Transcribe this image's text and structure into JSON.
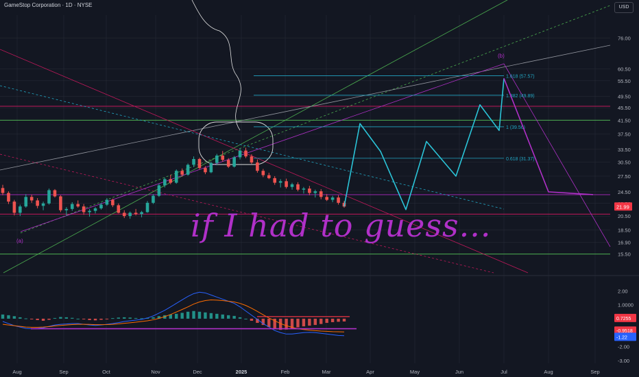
{
  "header": {
    "title": "GameStop Corporation · 1D · NYSE",
    "currency_button": "USD"
  },
  "annotation_text": "if I had to guess...",
  "colors": {
    "background": "#131722",
    "up": "#26a69a",
    "down": "#ef5350",
    "grid": "#2a2e39",
    "wick": "#4c5260",
    "fib": "#22a7c4",
    "magenta": "#b030c8",
    "cyan_sketch": "#2bc4d8",
    "green_line": "#4caf50",
    "red_level": "#c2185b",
    "macd_line": "#2962ff",
    "signal_line": "#ff6d00",
    "price_tag": "#f23645"
  },
  "chart_data": [
    {
      "type": "candlestick",
      "title": "GameStop Corporation · 1D · NYSE",
      "ylim": [
        13.5,
        90
      ],
      "y_scale": "log",
      "y_ticks": [
        "76.00",
        "60.50",
        "55.50",
        "49.50",
        "45.50",
        "41.50",
        "37.50",
        "33.50",
        "30.50",
        "27.50",
        "24.50",
        "22.50",
        "20.50",
        "18.50",
        "16.90",
        "15.50"
      ],
      "x_ticks": [
        "Aug",
        "Sep",
        "Oct",
        "Nov",
        "Dec",
        "2025",
        "Feb",
        "Mar",
        "Apr",
        "May",
        "Jun",
        "Jul",
        "Aug",
        "Sep"
      ],
      "last_price_tag": "21.99",
      "horizontal_levels": [
        {
          "value": 46.0,
          "color": "#c2185b"
        },
        {
          "value": 41.5,
          "color": "#4caf50"
        },
        {
          "value": 24.0,
          "color": "#9c27b0"
        },
        {
          "value": 20.8,
          "color": "#c2185b"
        },
        {
          "value": 15.5,
          "color": "#4caf50"
        }
      ],
      "fib_levels": [
        {
          "label": "1.618 (57.57)",
          "value": 57.57
        },
        {
          "label": "1.382 (49.89)",
          "value": 49.89
        },
        {
          "label": "1 (39.56)",
          "value": 39.56
        },
        {
          "label": "0.618 (31.37)",
          "value": 31.37
        }
      ],
      "wave_labels": [
        "(a)",
        "(b)"
      ],
      "series": [
        {
          "segment": "Jul 2024 – Mar 2025 (candles)",
          "ohlc": [
            [
              25.2,
              25.8,
              23.9,
              24.3
            ],
            [
              24.3,
              24.6,
              22.4,
              22.8
            ],
            [
              22.8,
              23.1,
              20.6,
              21.0
            ],
            [
              21.0,
              22.3,
              20.5,
              22.0
            ],
            [
              22.0,
              24.1,
              21.8,
              23.6
            ],
            [
              23.6,
              24.0,
              22.6,
              23.0
            ],
            [
              23.0,
              23.4,
              21.7,
              22.1
            ],
            [
              22.1,
              22.8,
              21.4,
              22.5
            ],
            [
              22.5,
              25.1,
              22.3,
              24.8
            ],
            [
              24.8,
              25.0,
              23.5,
              23.7
            ],
            [
              23.7,
              23.9,
              21.1,
              21.4
            ],
            [
              21.4,
              21.9,
              20.6,
              21.6
            ],
            [
              21.6,
              22.7,
              21.3,
              22.4
            ],
            [
              22.4,
              23.0,
              21.8,
              22.0
            ],
            [
              22.0,
              22.4,
              20.7,
              21.1
            ],
            [
              21.1,
              21.6,
              20.4,
              21.3
            ],
            [
              21.3,
              21.9,
              20.9,
              21.7
            ],
            [
              21.7,
              22.6,
              21.5,
              22.3
            ],
            [
              22.3,
              23.4,
              22.1,
              23.1
            ],
            [
              23.1,
              23.3,
              21.9,
              22.2
            ],
            [
              22.2,
              22.5,
              20.9,
              21.0
            ],
            [
              21.0,
              21.4,
              20.2,
              20.5
            ],
            [
              20.5,
              21.2,
              20.1,
              21.0
            ],
            [
              21.0,
              21.6,
              20.6,
              20.8
            ],
            [
              20.8,
              21.3,
              20.3,
              21.1
            ],
            [
              21.1,
              22.9,
              21.0,
              22.6
            ],
            [
              22.6,
              24.1,
              22.4,
              23.8
            ],
            [
              23.8,
              26.0,
              23.6,
              25.7
            ],
            [
              25.7,
              27.2,
              25.3,
              26.9
            ],
            [
              26.9,
              27.8,
              25.9,
              26.2
            ],
            [
              26.2,
              28.9,
              26.0,
              28.6
            ],
            [
              28.6,
              29.1,
              27.4,
              27.8
            ],
            [
              27.8,
              30.2,
              27.6,
              29.9
            ],
            [
              29.9,
              31.8,
              29.4,
              31.2
            ],
            [
              31.2,
              31.5,
              28.9,
              29.2
            ],
            [
              29.2,
              29.6,
              27.9,
              28.3
            ],
            [
              28.3,
              30.6,
              28.1,
              30.3
            ],
            [
              30.3,
              32.4,
              29.8,
              32.0
            ],
            [
              32.0,
              33.1,
              30.6,
              31.0
            ],
            [
              31.0,
              31.4,
              29.2,
              29.5
            ],
            [
              29.5,
              31.9,
              29.3,
              31.6
            ],
            [
              31.6,
              33.7,
              31.1,
              33.2
            ],
            [
              33.2,
              33.9,
              31.4,
              31.8
            ],
            [
              31.8,
              32.3,
              30.1,
              30.4
            ],
            [
              30.4,
              31.1,
              28.2,
              28.6
            ],
            [
              28.6,
              29.0,
              27.3,
              27.7
            ],
            [
              27.7,
              28.2,
              26.9,
              27.1
            ],
            [
              27.1,
              27.5,
              25.8,
              26.2
            ],
            [
              26.2,
              26.9,
              25.3,
              26.5
            ],
            [
              26.5,
              27.0,
              25.1,
              25.4
            ],
            [
              25.4,
              26.2,
              24.9,
              25.9
            ],
            [
              25.9,
              26.3,
              24.6,
              24.9
            ],
            [
              24.9,
              25.4,
              24.2,
              25.1
            ],
            [
              25.1,
              25.6,
              23.9,
              24.3
            ],
            [
              24.3,
              24.9,
              23.5,
              24.6
            ],
            [
              24.6,
              25.0,
              23.2,
              23.6
            ],
            [
              23.6,
              24.1,
              22.9,
              23.1
            ],
            [
              23.1,
              23.8,
              22.7,
              23.5
            ],
            [
              23.5,
              23.9,
              22.3,
              22.6
            ],
            [
              22.6,
              22.9,
              21.8,
              21.99
            ]
          ]
        },
        {
          "segment": "Mar – Sep 2025 (cyan projected path)",
          "points": [
            [
              "Mar",
              22.0
            ],
            [
              "Apr",
              40.5
            ],
            [
              "Apr",
              33.0
            ],
            [
              "May",
              21.5
            ],
            [
              "May",
              35.5
            ],
            [
              "Jun",
              27.5
            ],
            [
              "Jun",
              46.5
            ],
            [
              "Jun",
              38.5
            ],
            [
              "Jul",
              56.5
            ]
          ]
        },
        {
          "segment": "Jul – Sep 2025 (magenta projected path)",
          "points": [
            [
              "Jul",
              56.5
            ],
            [
              "Aug",
              24.5
            ],
            [
              "Sep",
              24.0
            ]
          ]
        }
      ]
    },
    {
      "type": "line",
      "name": "MACD",
      "ylim": [
        -3.2,
        2.8
      ],
      "y_ticks": [
        "2.00",
        "1.0000",
        "0.0000",
        "-1.0000",
        "-2.00",
        "-3.00"
      ],
      "value_tags": [
        {
          "label": "0.7255",
          "color": "#f23645"
        },
        {
          "label": "-0.9518",
          "color": "#f23645"
        },
        {
          "label": "-1.22",
          "color": "#2962ff"
        }
      ],
      "histogram": [
        0.3,
        0.25,
        0.18,
        0.1,
        0.02,
        -0.05,
        -0.1,
        -0.15,
        -0.08,
        0.05,
        0.12,
        0.1,
        0.06,
        0.0,
        -0.05,
        -0.1,
        -0.12,
        -0.08,
        -0.02,
        0.04,
        0.08,
        0.1,
        0.08,
        0.05,
        0.03,
        0.06,
        0.1,
        0.18,
        0.25,
        0.3,
        0.35,
        0.42,
        0.5,
        0.55,
        0.5,
        0.45,
        0.4,
        0.35,
        0.3,
        0.25,
        0.2,
        0.1,
        0.0,
        -0.15,
        -0.3,
        -0.45,
        -0.6,
        -0.72,
        -0.8,
        -0.78,
        -0.7,
        -0.62,
        -0.55,
        -0.5,
        -0.45,
        -0.38,
        -0.3,
        -0.25,
        -0.22,
        -0.2
      ],
      "series": [
        {
          "name": "MACD",
          "values": [
            -0.2,
            -0.35,
            -0.5,
            -0.6,
            -0.7,
            -0.72,
            -0.7,
            -0.65,
            -0.55,
            -0.45,
            -0.4,
            -0.38,
            -0.35,
            -0.35,
            -0.4,
            -0.45,
            -0.48,
            -0.45,
            -0.4,
            -0.35,
            -0.28,
            -0.2,
            -0.15,
            -0.1,
            -0.05,
            0.05,
            0.2,
            0.4,
            0.6,
            0.85,
            1.1,
            1.35,
            1.6,
            1.8,
            1.9,
            1.85,
            1.7,
            1.55,
            1.4,
            1.25,
            1.1,
            0.85,
            0.55,
            0.25,
            -0.05,
            -0.35,
            -0.6,
            -0.85,
            -1.0,
            -1.1,
            -1.1,
            -1.05,
            -1.0,
            -0.98,
            -1.0,
            -1.05,
            -1.1,
            -1.15,
            -1.2,
            -1.22
          ]
        },
        {
          "name": "Signal",
          "values": [
            -0.4,
            -0.45,
            -0.5,
            -0.55,
            -0.6,
            -0.62,
            -0.62,
            -0.6,
            -0.57,
            -0.52,
            -0.48,
            -0.45,
            -0.42,
            -0.4,
            -0.4,
            -0.41,
            -0.43,
            -0.43,
            -0.42,
            -0.4,
            -0.37,
            -0.33,
            -0.29,
            -0.25,
            -0.2,
            -0.15,
            -0.08,
            0.02,
            0.15,
            0.3,
            0.48,
            0.66,
            0.85,
            1.05,
            1.2,
            1.3,
            1.35,
            1.33,
            1.3,
            1.25,
            1.2,
            1.1,
            0.95,
            0.75,
            0.52,
            0.28,
            0.05,
            -0.15,
            -0.35,
            -0.5,
            -0.62,
            -0.72,
            -0.78,
            -0.82,
            -0.86,
            -0.89,
            -0.91,
            -0.93,
            -0.94,
            -0.95
          ]
        }
      ],
      "drawn_levels": [
        0.15,
        -0.72
      ]
    }
  ]
}
